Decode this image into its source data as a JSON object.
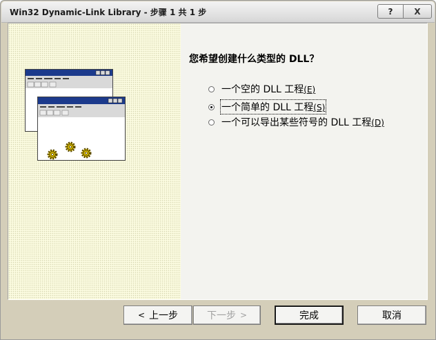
{
  "window": {
    "title": "Win32 Dynamic-Link Library - 步骤 1 共 1 步",
    "help_button": "?",
    "close_button": "X"
  },
  "wizard": {
    "question": "您希望创建什么类型的 DLL？",
    "options": [
      {
        "label": "一个空的 DLL 工程",
        "mnemonic": "(E)",
        "selected": false
      },
      {
        "label": "一个简单的 DLL 工程",
        "mnemonic": "(S)",
        "selected": true
      },
      {
        "label": "一个可以导出某些符号的 DLL 工程",
        "mnemonic": "(D)",
        "selected": false
      }
    ]
  },
  "buttons": {
    "back": {
      "chevron": "<",
      "label": "上一步"
    },
    "next": {
      "label": "下一步",
      "chevron": ">"
    },
    "finish": "完成",
    "cancel": "取消"
  },
  "colors": {
    "illustration_background": "#fbfbe0",
    "window_face": "#d4ceb9",
    "client_face": "#f3f3ef",
    "mini_titlebar": "#1c3a8c",
    "gear": "#f0d000"
  }
}
